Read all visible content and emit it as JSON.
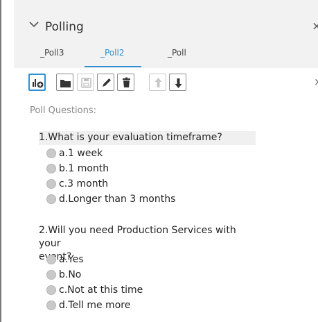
{
  "panel": {
    "title": "Polling"
  },
  "tabs": [
    {
      "label": "_Poll3"
    },
    {
      "label": "_Poll2",
      "active": true
    },
    {
      "label": "_Poll"
    }
  ],
  "toolbar": {
    "icons": [
      "add-poll-icon",
      "folder-icon",
      "save-icon",
      "pencil-icon",
      "trash-icon",
      "arrow-up-icon",
      "arrow-down-icon"
    ]
  },
  "content": {
    "label": "Poll Questions:",
    "questions": [
      {
        "title": "1.What is your evaluation timeframe?",
        "options": [
          "a.1 week",
          "b.1 month",
          "c.3 month",
          "d.Longer than 3 months"
        ]
      },
      {
        "title_line1": "2.Will you need Production Services with your",
        "title_line2": "event?",
        "options": [
          "a.Yes",
          "b.No",
          "c.Not at this time",
          "d.Tell me more"
        ]
      }
    ]
  },
  "colors": {
    "accent": "#2f8fd3",
    "header_bg": "#f2f2f2",
    "radio": "#c9c9c9"
  }
}
